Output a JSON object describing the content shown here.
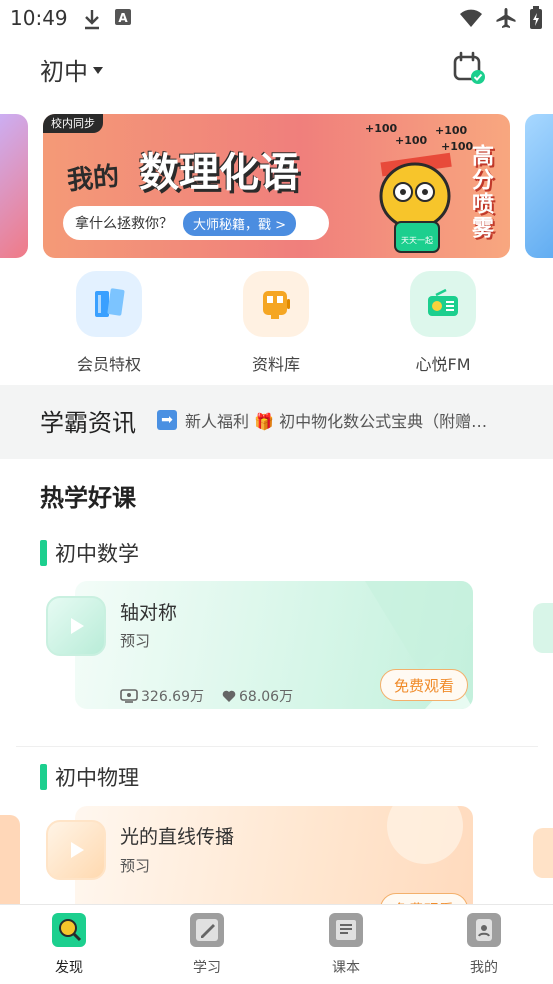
{
  "status_bar": {
    "time": "10:49",
    "icons": [
      "download-icon",
      "a-icon",
      "wifi-icon",
      "airplane-icon",
      "battery-icon"
    ]
  },
  "header": {
    "grade": "初中",
    "calendar_icon": "calendar-check-icon"
  },
  "banner": {
    "tag": "校内同步",
    "title_pre": "我的",
    "title_main": "数理化语",
    "pill_question": "拿什么拯救你？",
    "pill_cta": "大师秘籍，戳 >",
    "side_text": "高分喷雾",
    "score_badge": "+100",
    "mascot_badge": "天天一起"
  },
  "quick_entries": [
    {
      "label": "会员特权",
      "icon": "book-icon",
      "color": "#3aa0ff"
    },
    {
      "label": "资料库",
      "icon": "bus-icon",
      "color": "#f5a623"
    },
    {
      "label": "心悦FM",
      "icon": "radio-icon",
      "color": "#1ccf8e"
    }
  ],
  "news": {
    "title": "学霸资讯",
    "ticker": "新人福利 🎁 初中物化数公式宝典（附赠…"
  },
  "hot_section": {
    "title": "热学好课",
    "subjects": [
      {
        "label": "初中数学",
        "course": {
          "name": "轴对称",
          "tag": "预习",
          "views": "326.69万",
          "likes": "68.06万",
          "button": "免费观看"
        }
      },
      {
        "label": "初中物理",
        "course": {
          "name": "光的直线传播",
          "tag": "预习",
          "button": "免费观看"
        }
      }
    ]
  },
  "bottom_nav": [
    {
      "label": "发现",
      "icon": "discover-icon",
      "active": true
    },
    {
      "label": "学习",
      "icon": "study-icon",
      "active": false
    },
    {
      "label": "课本",
      "icon": "textbook-icon",
      "active": false
    },
    {
      "label": "我的",
      "icon": "profile-icon",
      "active": false
    }
  ],
  "colors": {
    "accent_green": "#1ccf8e",
    "button_orange": "#f08b2a"
  }
}
